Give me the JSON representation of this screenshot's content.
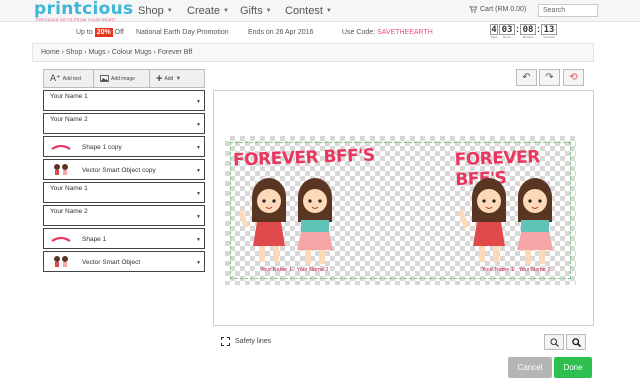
{
  "brand": {
    "name": "printcious",
    "tagline": "PRECIOUS GIFTS FROM YOUR HEART"
  },
  "nav": {
    "items": [
      "Shop",
      "Create",
      "Gifts",
      "Contest"
    ],
    "cart": "Cart (RM 0.00)",
    "search_placeholder": "Search"
  },
  "promo": {
    "up_to": "Up to",
    "pct": "20%",
    "off": "Off",
    "event": "National Earth Day Promotion",
    "ends": "Ends on 26 Apr 2016",
    "code_label": "Use Code:",
    "code": "SAVETHEEARTH"
  },
  "timer": {
    "days": "4",
    "hours": "03",
    "minutes": "08",
    "seconds": "13",
    "labels": [
      "Days",
      "Hours",
      "Minutes",
      "Seconds"
    ]
  },
  "breadcrumb": "Home  ›  Shop  ›  Mugs  ›  Colour Mugs  ›  Forever Bff",
  "toolbar": {
    "add_text": "Add text",
    "add_image": "Add image",
    "add": "Add"
  },
  "layers": [
    {
      "label": "Your Name 1",
      "thumb": "none"
    },
    {
      "label": "Your Name 2",
      "thumb": "none"
    },
    {
      "label": "Shape 1 copy",
      "thumb": "text"
    },
    {
      "label": "Vector Smart Object copy",
      "thumb": "girls"
    },
    {
      "label": "Your Name 1",
      "thumb": "none"
    },
    {
      "label": "Your Name 2",
      "thumb": "none"
    },
    {
      "label": "Shape 1",
      "thumb": "text"
    },
    {
      "label": "Vector Smart Object",
      "thumb": "girls"
    }
  ],
  "design": {
    "title": "FOREVER BFF'S",
    "name1": "Your Name 1",
    "name2": "Your Name 2"
  },
  "safety_label": "Safety lines",
  "actions": {
    "cancel": "Cancel",
    "done": "Done"
  },
  "colors": {
    "accent": "#2ec04f",
    "brand": "#3fb5d8",
    "pink": "#e84c8b"
  }
}
